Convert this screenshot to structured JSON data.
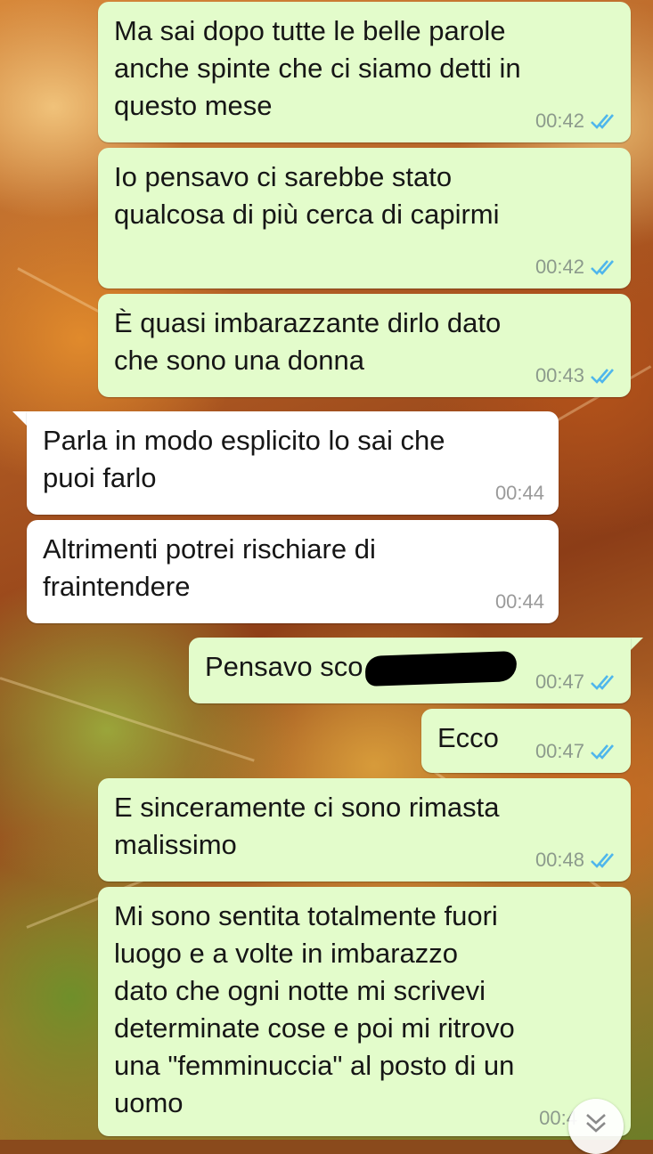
{
  "chat": {
    "messages": [
      {
        "direction": "out",
        "text": "Ma sai dopo tutte le belle parole\nanche spinte che ci siamo detti in\nquesto mese",
        "time": "00:42",
        "status": "read"
      },
      {
        "direction": "out",
        "text": "Io pensavo ci sarebbe stato\nqualcosa di più cerca di capirmi",
        "time": "00:42",
        "status": "read"
      },
      {
        "direction": "out",
        "text": "È quasi imbarazzante dirlo dato\nche sono una donna",
        "time": "00:43",
        "status": "read"
      },
      {
        "direction": "in",
        "text": "Parla in modo esplicito lo sai che\npuoi farlo",
        "time": "00:44"
      },
      {
        "direction": "in",
        "text": "Altrimenti potrei rischiare di\nfraintendere",
        "time": "00:44"
      },
      {
        "direction": "out",
        "text": "Pensavo sco",
        "time": "00:47",
        "status": "read",
        "redacted": true
      },
      {
        "direction": "out",
        "text": "Ecco",
        "time": "00:47",
        "status": "read"
      },
      {
        "direction": "out",
        "text": "E sinceramente ci sono rimasta\nmalissimo",
        "time": "00:48",
        "status": "read"
      },
      {
        "direction": "out",
        "text": "Mi sono sentita totalmente fuori\nluogo e a volte in imbarazzo\ndato che ogni notte mi scrivevi\ndeterminate cose e poi mi ritrovo\nuna \"femminuccia\" al posto di un\nuomo",
        "time": "00:4",
        "status": "read"
      }
    ]
  },
  "colors": {
    "outgoing_bubble": "#e3fccb",
    "incoming_bubble": "#ffffff",
    "read_ticks": "#4fb6ec",
    "timestamp": "#8c9a8c"
  },
  "icons": {
    "read_receipt": "double-check-icon",
    "scroll_down": "double-chevron-down-icon"
  }
}
